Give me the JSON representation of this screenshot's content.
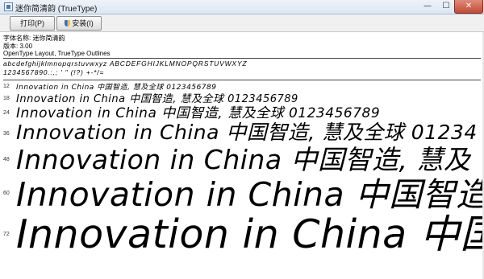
{
  "window": {
    "title": "迷你简清韵 (TrueType)",
    "controls": {
      "minimize": "—",
      "maximize": "☐",
      "close": "✕"
    }
  },
  "toolbar": {
    "print_label": "打印(P)",
    "install_label": "安装(I)"
  },
  "font_info": {
    "name_line": "字体名称: 迷你简清韵",
    "version_line": "版本: 3.00",
    "format_line": "OpenType Layout, TrueType Outlines"
  },
  "charset": {
    "line1": "abcdefghijklmnopqrstuvwxyz ABCDEFGHIJKLMNOPQRSTUVWXYZ",
    "line2": "1234567890.:,; ' \" (!?) +-*/="
  },
  "samples": [
    {
      "size": "12",
      "text": "Innovation in China 中国智造, 慧及全球 0123456789"
    },
    {
      "size": "18",
      "text": "Innovation in China 中国智造, 慧及全球 0123456789"
    },
    {
      "size": "24",
      "text": "Innovation in China 中国智造, 慧及全球 0123456789"
    },
    {
      "size": "36",
      "text": "Innovation in China 中国智造, 慧及全球 01234"
    },
    {
      "size": "48",
      "text": "Innovation in China 中国智造, 慧及"
    },
    {
      "size": "60",
      "text": "Innovation in China 中国智造"
    },
    {
      "size": "72",
      "text": "Innovation in China 中国"
    }
  ]
}
